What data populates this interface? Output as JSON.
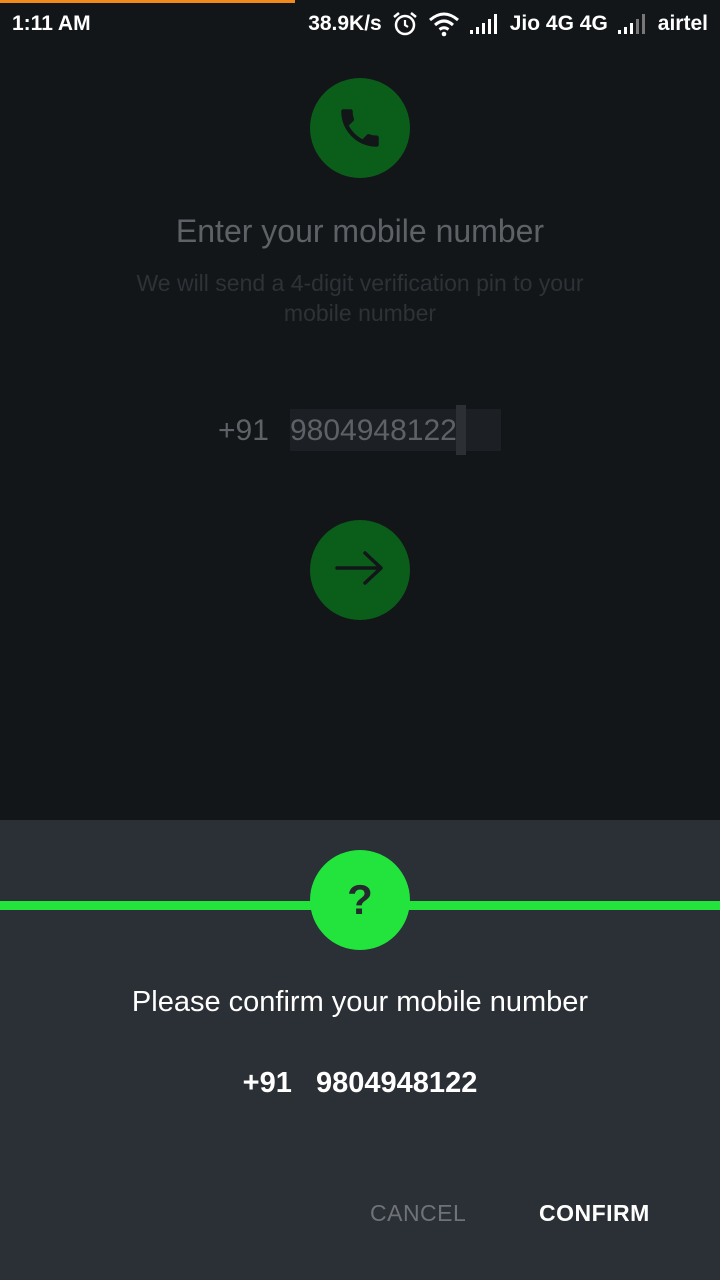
{
  "status_bar": {
    "time": "1:11 AM",
    "speed": "38.9K/s",
    "carrier1": "Jio 4G 4G",
    "carrier2": "airtel",
    "icons": [
      "alarm-icon",
      "wifi-icon",
      "signal-icon",
      "signal-weak-icon"
    ]
  },
  "top_progress_color": "#f08a1c",
  "registration": {
    "icon": "phone-icon",
    "title": "Enter your mobile number",
    "subtitle": "We will send a 4-digit verification pin to your mobile number",
    "country_code": "+91",
    "phone_value": "9804948122",
    "next_icon": "arrow-right-icon"
  },
  "dialog": {
    "icon_text": "?",
    "title": "Please confirm your mobile number",
    "number": "+91   9804948122",
    "cancel_label": "CANCEL",
    "confirm_label": "CONFIRM",
    "accent_color": "#22e43d"
  }
}
